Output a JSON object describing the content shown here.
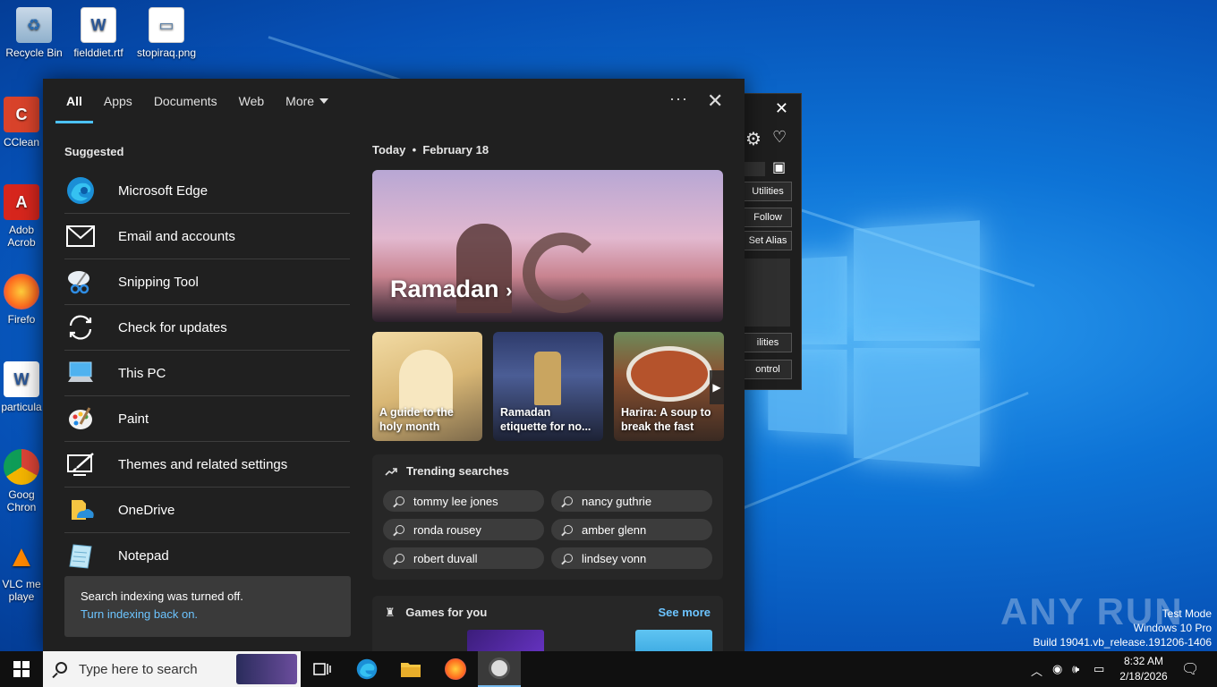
{
  "desktop": {
    "icons": [
      {
        "label": "Recycle Bin",
        "icon": "recycle-bin-icon"
      },
      {
        "label": "fielddiet.rtf",
        "icon": "word-document-icon"
      },
      {
        "label": "stopiraq.png",
        "icon": "image-file-icon"
      },
      {
        "label": "CClean",
        "icon": "ccleaner-icon"
      },
      {
        "label": "Adob Acrob",
        "icon": "acrobat-icon"
      },
      {
        "label": "Firefo",
        "icon": "firefox-icon"
      },
      {
        "label": "particula",
        "icon": "word-document-icon"
      },
      {
        "label": "Goog Chron",
        "icon": "chrome-icon"
      },
      {
        "label": "VLC me playe",
        "icon": "vlc-icon"
      }
    ]
  },
  "tool_window": {
    "buttons": [
      "Utilities",
      "Follow",
      "Set Alias",
      "ilities",
      "ontrol"
    ]
  },
  "search": {
    "tabs": [
      {
        "label": "All",
        "active": true
      },
      {
        "label": "Apps"
      },
      {
        "label": "Documents"
      },
      {
        "label": "Web"
      },
      {
        "label": "More"
      }
    ],
    "more_options": "···",
    "suggested_title": "Suggested",
    "suggested": [
      {
        "label": "Microsoft Edge",
        "icon": "edge-icon"
      },
      {
        "label": "Email and accounts",
        "icon": "mail-icon"
      },
      {
        "label": "Snipping Tool",
        "icon": "scissors-icon"
      },
      {
        "label": "Check for updates",
        "icon": "sync-icon"
      },
      {
        "label": "This PC",
        "icon": "computer-icon"
      },
      {
        "label": "Paint",
        "icon": "palette-icon"
      },
      {
        "label": "Themes and related settings",
        "icon": "theme-brush-icon"
      },
      {
        "label": "OneDrive",
        "icon": "onedrive-icon"
      },
      {
        "label": "Notepad",
        "icon": "notepad-icon"
      }
    ],
    "notice": {
      "message": "Search indexing was turned off.",
      "link": "Turn indexing back on."
    },
    "today": {
      "label": "Today",
      "date": "February 18"
    },
    "hero": {
      "title": "Ramadan"
    },
    "cards": [
      {
        "text": "A guide to the holy month"
      },
      {
        "text": "Ramadan etiquette for no..."
      },
      {
        "text": "Harira: A soup to break the fast"
      }
    ],
    "trending": {
      "title": "Trending searches",
      "items": [
        "tommy lee jones",
        "nancy guthrie",
        "ronda rousey",
        "amber glenn",
        "robert duvall",
        "lindsey vonn"
      ]
    },
    "games": {
      "title": "Games for you",
      "see_more": "See more"
    }
  },
  "watermark": {
    "brand": "ANY RUN",
    "mode": "Test Mode",
    "os": "Windows 10 Pro",
    "build": "Build 19041.vb_release.191206-1406"
  },
  "taskbar": {
    "search_placeholder": "Type here to search",
    "time": "8:32 AM",
    "date": "2/18/2026"
  },
  "colors": {
    "accent": "#4cc2ff",
    "link": "#6cc4ff",
    "panel_bg": "#202020"
  }
}
